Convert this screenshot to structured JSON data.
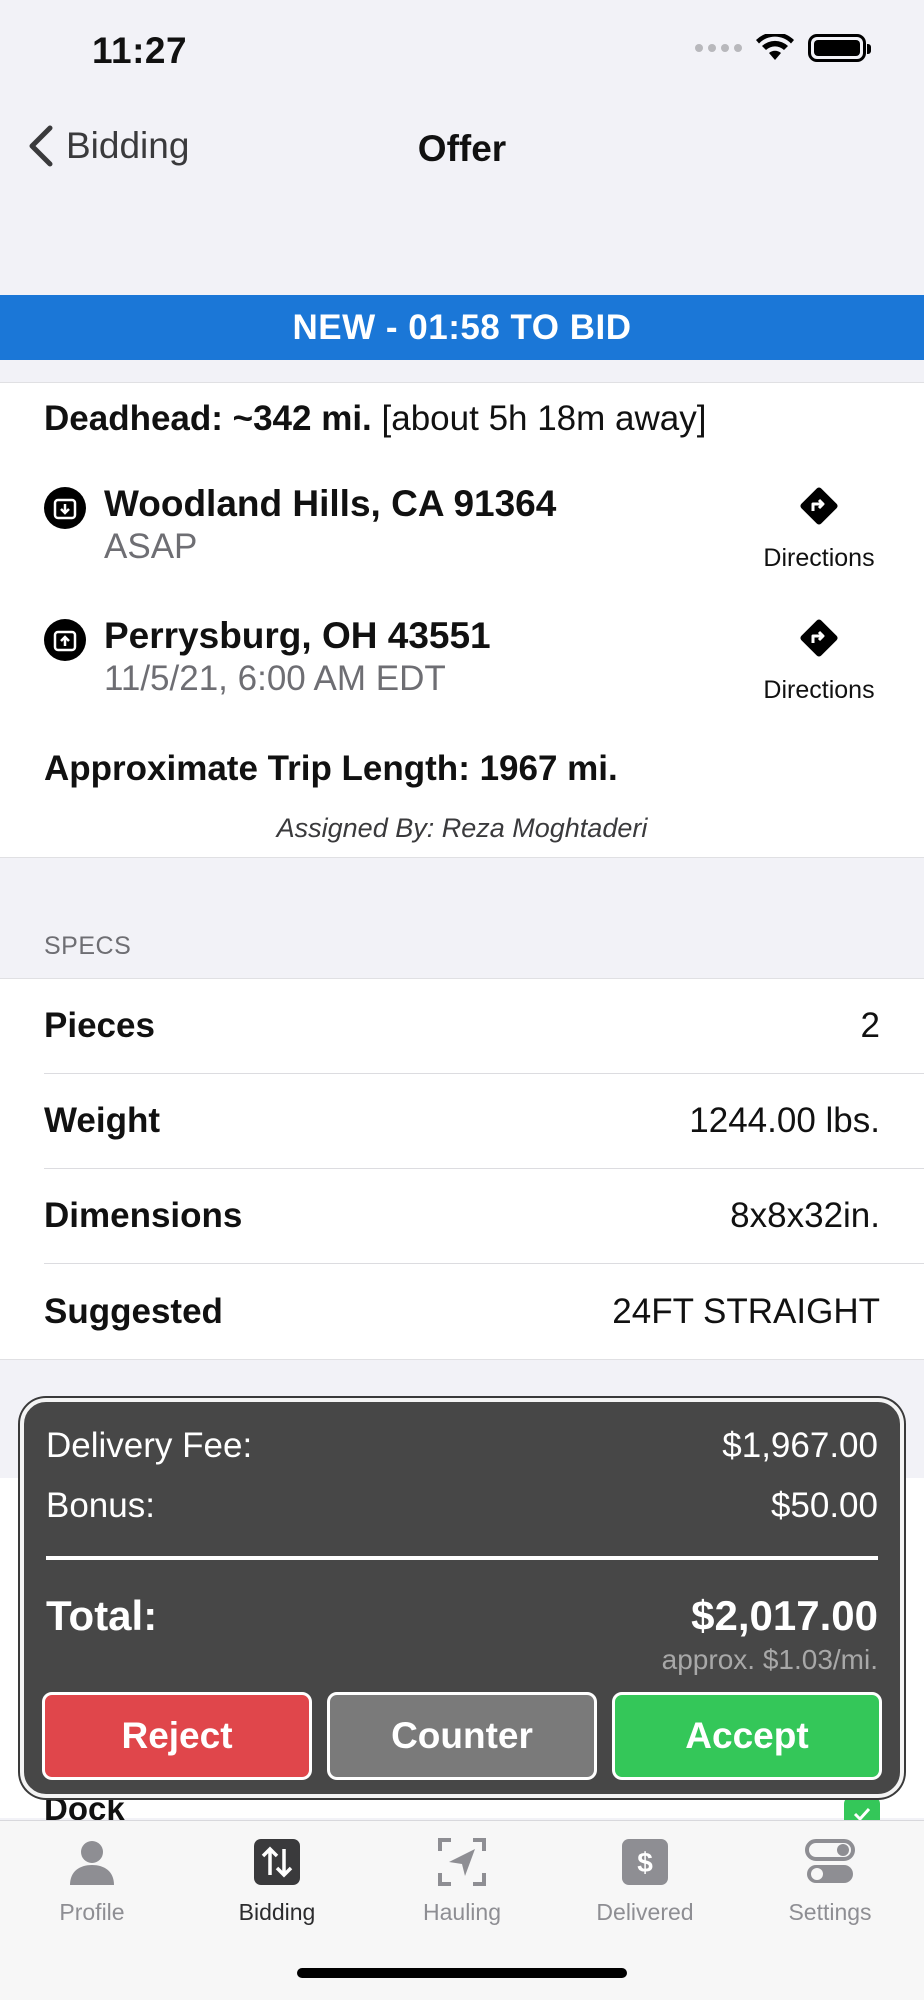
{
  "status_bar": {
    "time": "11:27"
  },
  "nav": {
    "back_label": "Bidding",
    "title": "Offer"
  },
  "banner": {
    "text": "NEW - 01:58 TO BID",
    "color": "#1b77d7"
  },
  "trip": {
    "deadhead_label": "Deadhead: ~342 mi.",
    "deadhead_eta": "[about 5h 18m away]",
    "pickup": {
      "location": "Woodland Hills, CA 91364",
      "time": "ASAP",
      "directions_label": "Directions"
    },
    "dropoff": {
      "location": "Perrysburg, OH 43551",
      "time": "11/5/21, 6:00 AM EDT",
      "directions_label": "Directions"
    },
    "trip_length": "Approximate Trip Length: 1967 mi.",
    "assigned_by": "Assigned By: Reza Moghtaderi"
  },
  "specs": {
    "header": "SPECS",
    "rows": [
      {
        "label": "Pieces",
        "value": "2"
      },
      {
        "label": "Weight",
        "value": "1244.00 lbs."
      },
      {
        "label": "Dimensions",
        "value": "8x8x32in."
      },
      {
        "label": "Suggested",
        "value": "24FT STRAIGHT"
      }
    ]
  },
  "dock": {
    "label": "Dock"
  },
  "fees": {
    "delivery_label": "Delivery Fee:",
    "delivery_value": "$1,967.00",
    "bonus_label": "Bonus:",
    "bonus_value": "$50.00",
    "total_label": "Total:",
    "total_value": "$2,017.00",
    "per_mile": "approx. $1.03/mi.",
    "reject_label": "Reject",
    "counter_label": "Counter",
    "accept_label": "Accept",
    "colors": {
      "reject": "#e0464b",
      "counter": "#7a7a7a",
      "accept": "#34c759"
    }
  },
  "tabs": [
    {
      "label": "Profile",
      "icon": "person-icon"
    },
    {
      "label": "Bidding",
      "icon": "arrows-up-down-icon",
      "active": true
    },
    {
      "label": "Hauling",
      "icon": "navigation-arrow-icon"
    },
    {
      "label": "Delivered",
      "icon": "dollar-icon"
    },
    {
      "label": "Settings",
      "icon": "toggles-icon"
    }
  ]
}
